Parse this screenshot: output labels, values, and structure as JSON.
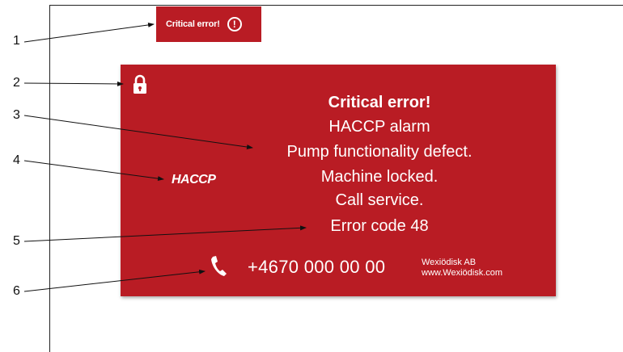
{
  "status_badge": {
    "label": "Critical error!",
    "icon": "exclamation-circle-icon"
  },
  "panel": {
    "background_color": "#b91c24",
    "lock_icon": "lock-icon",
    "logo_text": "HACCP",
    "lines": [
      "Critical error!",
      "HACCP alarm",
      "Pump functionality defect.",
      "Machine locked.",
      "Call service.",
      "Error code 48"
    ],
    "phone_icon": "phone-icon",
    "phone_number": "+4670 000 00 00",
    "company_name": "Wexiödisk AB",
    "company_url": "www.Wexiödisk.com"
  },
  "callouts": [
    "1",
    "2",
    "3",
    "4",
    "5",
    "6"
  ]
}
